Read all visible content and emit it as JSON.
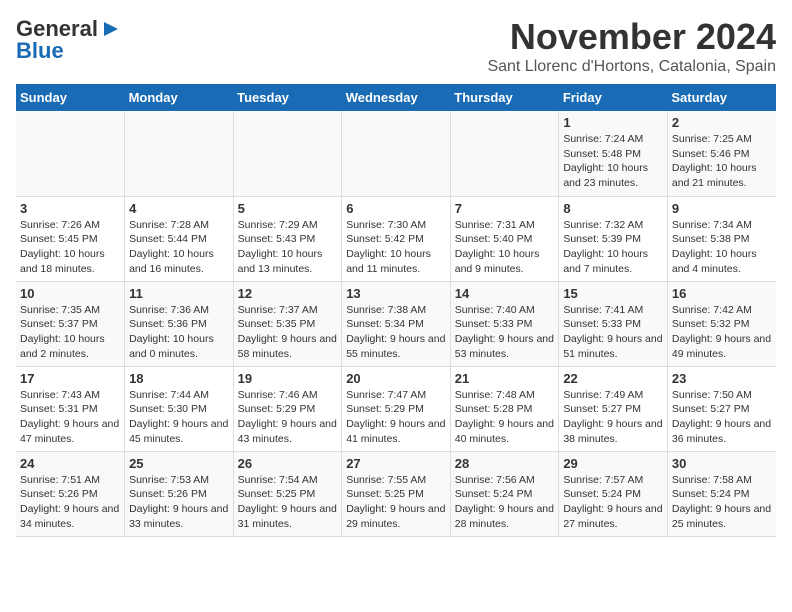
{
  "logo": {
    "line1": "General",
    "line2": "Blue"
  },
  "title": "November 2024",
  "subtitle": "Sant Llorenc d'Hortons, Catalonia, Spain",
  "headers": [
    "Sunday",
    "Monday",
    "Tuesday",
    "Wednesday",
    "Thursday",
    "Friday",
    "Saturday"
  ],
  "weeks": [
    [
      {
        "day": "",
        "info": ""
      },
      {
        "day": "",
        "info": ""
      },
      {
        "day": "",
        "info": ""
      },
      {
        "day": "",
        "info": ""
      },
      {
        "day": "",
        "info": ""
      },
      {
        "day": "1",
        "info": "Sunrise: 7:24 AM\nSunset: 5:48 PM\nDaylight: 10 hours and 23 minutes."
      },
      {
        "day": "2",
        "info": "Sunrise: 7:25 AM\nSunset: 5:46 PM\nDaylight: 10 hours and 21 minutes."
      }
    ],
    [
      {
        "day": "3",
        "info": "Sunrise: 7:26 AM\nSunset: 5:45 PM\nDaylight: 10 hours and 18 minutes."
      },
      {
        "day": "4",
        "info": "Sunrise: 7:28 AM\nSunset: 5:44 PM\nDaylight: 10 hours and 16 minutes."
      },
      {
        "day": "5",
        "info": "Sunrise: 7:29 AM\nSunset: 5:43 PM\nDaylight: 10 hours and 13 minutes."
      },
      {
        "day": "6",
        "info": "Sunrise: 7:30 AM\nSunset: 5:42 PM\nDaylight: 10 hours and 11 minutes."
      },
      {
        "day": "7",
        "info": "Sunrise: 7:31 AM\nSunset: 5:40 PM\nDaylight: 10 hours and 9 minutes."
      },
      {
        "day": "8",
        "info": "Sunrise: 7:32 AM\nSunset: 5:39 PM\nDaylight: 10 hours and 7 minutes."
      },
      {
        "day": "9",
        "info": "Sunrise: 7:34 AM\nSunset: 5:38 PM\nDaylight: 10 hours and 4 minutes."
      }
    ],
    [
      {
        "day": "10",
        "info": "Sunrise: 7:35 AM\nSunset: 5:37 PM\nDaylight: 10 hours and 2 minutes."
      },
      {
        "day": "11",
        "info": "Sunrise: 7:36 AM\nSunset: 5:36 PM\nDaylight: 10 hours and 0 minutes."
      },
      {
        "day": "12",
        "info": "Sunrise: 7:37 AM\nSunset: 5:35 PM\nDaylight: 9 hours and 58 minutes."
      },
      {
        "day": "13",
        "info": "Sunrise: 7:38 AM\nSunset: 5:34 PM\nDaylight: 9 hours and 55 minutes."
      },
      {
        "day": "14",
        "info": "Sunrise: 7:40 AM\nSunset: 5:33 PM\nDaylight: 9 hours and 53 minutes."
      },
      {
        "day": "15",
        "info": "Sunrise: 7:41 AM\nSunset: 5:33 PM\nDaylight: 9 hours and 51 minutes."
      },
      {
        "day": "16",
        "info": "Sunrise: 7:42 AM\nSunset: 5:32 PM\nDaylight: 9 hours and 49 minutes."
      }
    ],
    [
      {
        "day": "17",
        "info": "Sunrise: 7:43 AM\nSunset: 5:31 PM\nDaylight: 9 hours and 47 minutes."
      },
      {
        "day": "18",
        "info": "Sunrise: 7:44 AM\nSunset: 5:30 PM\nDaylight: 9 hours and 45 minutes."
      },
      {
        "day": "19",
        "info": "Sunrise: 7:46 AM\nSunset: 5:29 PM\nDaylight: 9 hours and 43 minutes."
      },
      {
        "day": "20",
        "info": "Sunrise: 7:47 AM\nSunset: 5:29 PM\nDaylight: 9 hours and 41 minutes."
      },
      {
        "day": "21",
        "info": "Sunrise: 7:48 AM\nSunset: 5:28 PM\nDaylight: 9 hours and 40 minutes."
      },
      {
        "day": "22",
        "info": "Sunrise: 7:49 AM\nSunset: 5:27 PM\nDaylight: 9 hours and 38 minutes."
      },
      {
        "day": "23",
        "info": "Sunrise: 7:50 AM\nSunset: 5:27 PM\nDaylight: 9 hours and 36 minutes."
      }
    ],
    [
      {
        "day": "24",
        "info": "Sunrise: 7:51 AM\nSunset: 5:26 PM\nDaylight: 9 hours and 34 minutes."
      },
      {
        "day": "25",
        "info": "Sunrise: 7:53 AM\nSunset: 5:26 PM\nDaylight: 9 hours and 33 minutes."
      },
      {
        "day": "26",
        "info": "Sunrise: 7:54 AM\nSunset: 5:25 PM\nDaylight: 9 hours and 31 minutes."
      },
      {
        "day": "27",
        "info": "Sunrise: 7:55 AM\nSunset: 5:25 PM\nDaylight: 9 hours and 29 minutes."
      },
      {
        "day": "28",
        "info": "Sunrise: 7:56 AM\nSunset: 5:24 PM\nDaylight: 9 hours and 28 minutes."
      },
      {
        "day": "29",
        "info": "Sunrise: 7:57 AM\nSunset: 5:24 PM\nDaylight: 9 hours and 27 minutes."
      },
      {
        "day": "30",
        "info": "Sunrise: 7:58 AM\nSunset: 5:24 PM\nDaylight: 9 hours and 25 minutes."
      }
    ]
  ]
}
